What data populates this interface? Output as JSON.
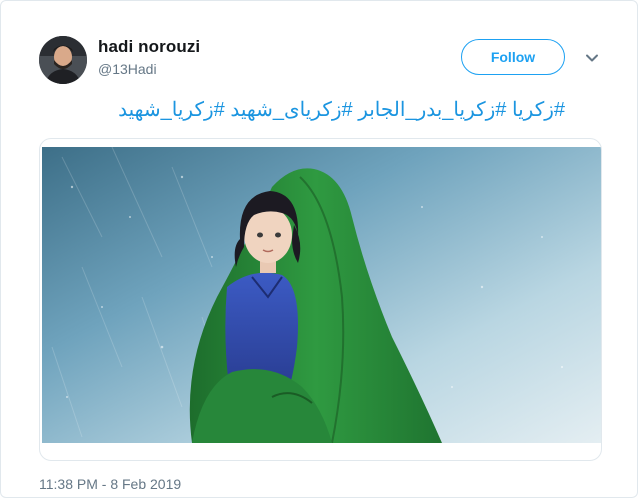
{
  "user": {
    "display_name": "hadi norouzi",
    "handle": "@13Hadi"
  },
  "actions": {
    "follow_label": "Follow"
  },
  "tweet": {
    "hashtags": [
      "#زکریا",
      "#زکریا_بدر_الجابر",
      "#زکریای_شهید",
      "#زکریا_شهید"
    ],
    "timestamp": "11:38 PM - 8 Feb 2019"
  },
  "colors": {
    "link_blue": "#1b95e0",
    "follow_blue": "#1da1f2",
    "cloak_green": "#2a8a3a",
    "sky_blue": "#7fb3c9"
  },
  "icons": {
    "more": "chevron-down-icon"
  }
}
